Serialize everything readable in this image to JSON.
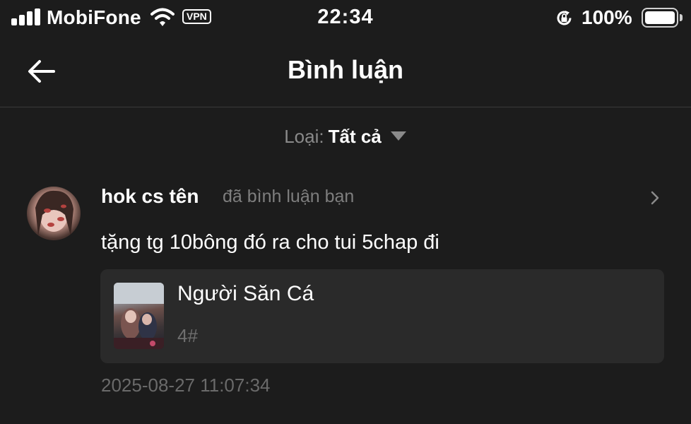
{
  "status_bar": {
    "carrier": "MobiFone",
    "vpn_label": "VPN",
    "time": "22:34",
    "battery_percent": "100%",
    "battery_level": 1.0,
    "signal_bars": 4
  },
  "nav": {
    "title": "Bình luận",
    "back_icon": "arrow-left-icon"
  },
  "filter": {
    "label": "Loại:",
    "value": "Tất cả",
    "caret_icon": "caret-down-icon"
  },
  "notification": {
    "username": "hok cs tên",
    "action": "đã bình luận bạn",
    "comment": "tặng tg 10bông đó ra cho tui 5chap đi",
    "manga": {
      "title": "Người Săn Cá",
      "chapter": "4#"
    },
    "timestamp": "2025-08-27 11:07:34",
    "chevron_icon": "chevron-right-icon"
  },
  "colors": {
    "background": "#1c1c1c",
    "card": "#2a2a2a",
    "muted_text": "#7e7e7e",
    "divider": "#3a3a3a"
  }
}
